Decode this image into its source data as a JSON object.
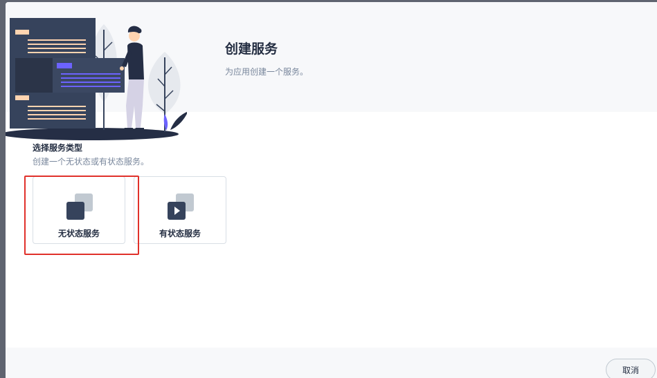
{
  "header": {
    "title": "创建服务",
    "subtitle": "为应用创建一个服务。"
  },
  "section": {
    "title": "选择服务类型",
    "description": "创建一个无状态或有状态服务。"
  },
  "service_types": [
    {
      "label": "无状态服务",
      "icon": "stateless-service-icon",
      "selected": true
    },
    {
      "label": "有状态服务",
      "icon": "stateful-service-icon",
      "selected": false
    }
  ],
  "footer": {
    "cancel_label": "取消"
  },
  "colors": {
    "text_primary": "#242e42",
    "text_secondary": "#79879c",
    "icon_dark": "#36435c",
    "icon_light": "#c1c9d1",
    "highlight": "#e0302a",
    "accent_purple": "#6c63ff",
    "accent_peach": "#ffd4b0"
  }
}
